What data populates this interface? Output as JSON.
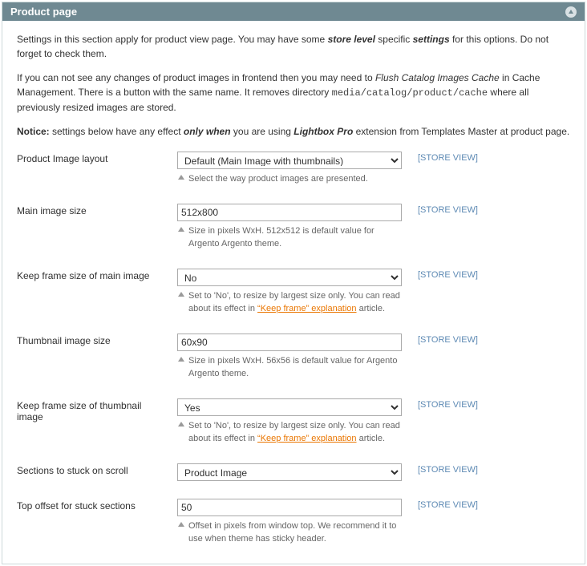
{
  "header": {
    "title": "Product page"
  },
  "intro": {
    "p1_a": "Settings in this section apply for product view page. You may have some ",
    "p1_b": "store level",
    "p1_c": " specific ",
    "p1_d": "settings",
    "p1_e": " for this options. Do not forget to check them.",
    "p2_a": "If you can not see any changes of product images in frontend then you may need to ",
    "p2_b": "Flush Catalog Images Cache",
    "p2_c": " in Cache Management. There is a button with the same name. It removes directory ",
    "p2_code": "media/catalog/product/cache",
    "p2_d": " where all previously resized images are stored.",
    "p3_a": "Notice:",
    "p3_b": " settings below have any effect ",
    "p3_c": "only when",
    "p3_d": " you are using ",
    "p3_e": "Lightbox Pro",
    "p3_f": " extension from Templates Master at product page."
  },
  "scope": "[STORE VIEW]",
  "keep_frame_link": "“Keep frame” explanation",
  "fields": {
    "layout": {
      "label": "Product Image layout",
      "value": "Default (Main Image with thumbnails)",
      "note": "Select the way product images are presented."
    },
    "main_size": {
      "label": "Main image size",
      "value": "512x800",
      "note": "Size in pixels WxH. 512x512 is default value for Argento Argento theme."
    },
    "keep_main": {
      "label": "Keep frame size of main image",
      "value": "No",
      "note_a": "Set to 'No', to resize by largest size only. You can read about its effect in ",
      "note_b": " article."
    },
    "thumb_size": {
      "label": "Thumbnail image size",
      "value": "60x90",
      "note": "Size in pixels WxH. 56x56 is default value for Argento Argento theme."
    },
    "keep_thumb": {
      "label": "Keep frame size of thumbnail image",
      "value": "Yes",
      "note_a": "Set to 'No', to resize by largest size only. You can read about its effect in ",
      "note_b": " article."
    },
    "stuck": {
      "label": "Sections to stuck on scroll",
      "value": "Product Image"
    },
    "offset": {
      "label": "Top offset for stuck sections",
      "value": "50",
      "note": "Offset in pixels from window top. We recommend it to use when theme has sticky header."
    }
  }
}
